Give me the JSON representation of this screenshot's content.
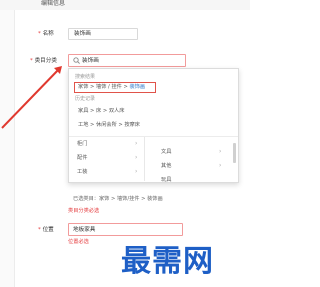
{
  "header": {
    "title": "编辑信息"
  },
  "form": {
    "name_label": "名称",
    "name_value": "装饰画",
    "category_label": "类目分类",
    "category_value": "装饰画",
    "location_label": "位置",
    "location_value": "地板家具",
    "required_mark": "*",
    "location_hint": "位置必选"
  },
  "dropdown": {
    "search_results_header": "搜索结果",
    "search_result": {
      "path": "家饰 > 墙饰 / 挂件 > ",
      "match": "装饰画"
    },
    "history_header": "历史记录",
    "history": [
      "家具 > 床 > 双人床",
      "工地 > 休闲会所 > 按摩床"
    ],
    "columns_left": [
      "柜门",
      "配件",
      "工装"
    ],
    "columns_right": [
      "文具",
      "其他",
      "玩具"
    ],
    "chevron": "›"
  },
  "selected_category": "已选类目：家饰 > 墙饰/挂件 > 装饰画",
  "category_hint": "类目分类必选",
  "watermark": "最需网",
  "colors": {
    "required": "#e4393c",
    "highlight_border": "#e0534a",
    "match_text": "#2f78c9",
    "arrow": "#e0392f",
    "watermark": "#1e5fc6"
  },
  "icons": {
    "search": "magnifier-icon",
    "chevron": "chevron-right-icon",
    "arrow": "arrow-pointer"
  }
}
